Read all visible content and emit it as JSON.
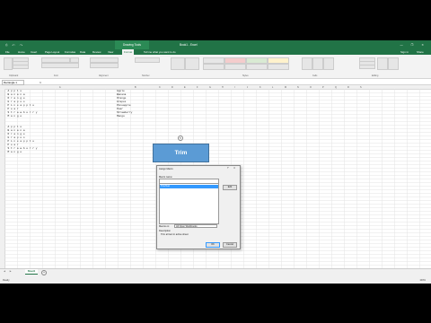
{
  "window": {
    "title": "Book1 - Excel",
    "context_tab": "Drawing Tools",
    "quick_access": "⎙ ↶ ↷",
    "controls": "— ❐ ✕"
  },
  "ribbon": {
    "tabs": [
      "File",
      "Home",
      "Insert",
      "Page Layout",
      "Formulas",
      "Data",
      "Review",
      "View",
      "Format"
    ],
    "active_tab": "Format",
    "tell_me": "Tell me what you want to do",
    "user": "Sign in",
    "share": "Share",
    "groups": [
      "Clipboard",
      "Font",
      "Alignment",
      "Number",
      "Styles",
      "Cells",
      "Editing"
    ]
  },
  "formula_bar": {
    "name_box": "Rectangle 1",
    "fx": "fx",
    "value": ""
  },
  "columns": [
    "A",
    "B",
    "C",
    "D",
    "E",
    "F",
    "G",
    "H",
    "I",
    "J",
    "K",
    "L",
    "M",
    "N",
    "O",
    "P",
    "Q",
    "R",
    "S"
  ],
  "cells": {
    "col_a": [
      "  A p p l e",
      "  B a n a n a",
      "  O r a n g e",
      "  G r a p e s",
      "  P i n e a p p l e",
      "  P e a r",
      "  S t r a w b e r r y",
      "  M a n g o",
      "",
      "",
      "  A p p l e",
      "  B a n a n a",
      "  O r a n g e",
      "  G r a p e s",
      "  P i n e a p p l e",
      "  P e a r",
      "  S t r a w b e r r y",
      "  M a n g o"
    ],
    "col_e": [
      "Apple",
      "Banana",
      "Orange",
      "Grapes",
      "Pineapple",
      "Pear",
      "Strawberry",
      "Mango"
    ]
  },
  "shape": {
    "text": "Trim",
    "fill": "#5b9bd5"
  },
  "dialog": {
    "title": "Assign Macro",
    "help": "?",
    "close": "✕",
    "macro_name_label": "Macro name:",
    "macro_name_value": "",
    "list_items": [
      "TrimText"
    ],
    "edit_button": "Edit",
    "macros_in_label": "Macros in:",
    "macros_in_value": "All Open Workbooks",
    "description_label": "Description",
    "description_text": "Trim all text in active sheet",
    "ok_button": "OK",
    "cancel_button": "Cancel"
  },
  "sheet_tabs": [
    "Sheet1"
  ],
  "status": {
    "mode": "Ready",
    "zoom": "100%"
  },
  "colors": {
    "excel_green": "#217346",
    "shape_blue": "#5b9bd5",
    "selection_blue": "#3399ff"
  }
}
